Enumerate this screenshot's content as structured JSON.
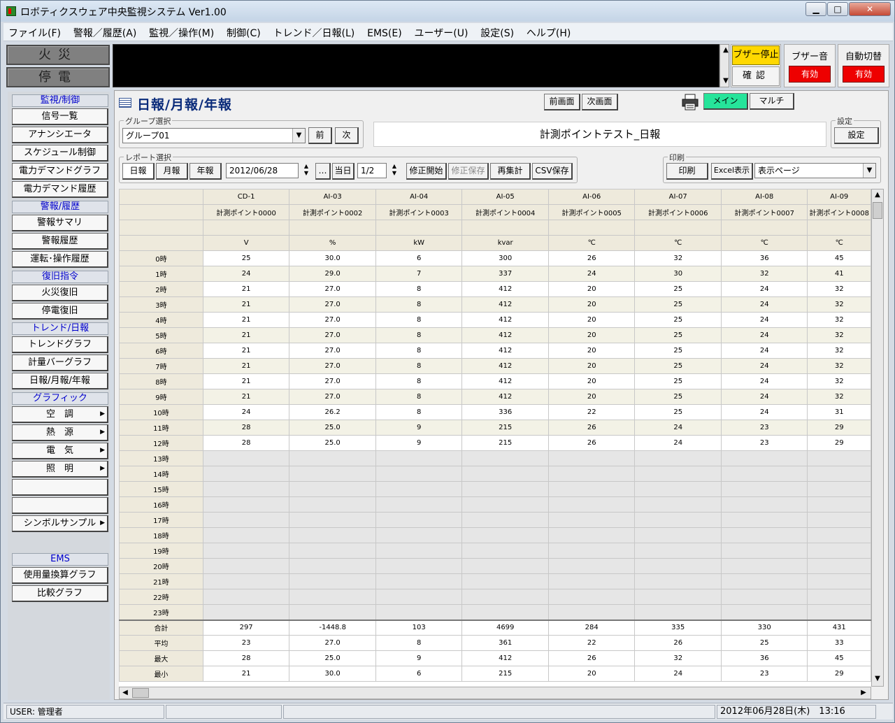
{
  "window": {
    "title": "ロボティクスウェア中央監視システム Ver1.00",
    "min": "▁",
    "max": "□",
    "close": "✕"
  },
  "menu": [
    "ファイル(F)",
    "警報／履歴(A)",
    "監視／操作(M)",
    "制御(C)",
    "トレンド／日報(L)",
    "EMS(E)",
    "ユーザー(U)",
    "設定(S)",
    "ヘルプ(H)"
  ],
  "alarms": {
    "fire": "火災",
    "power": "停電"
  },
  "buzzer": {
    "stop": "ブザー停止",
    "confirm": "確認",
    "sound_label": "ブザー音",
    "sound_state": "有効",
    "auto_label": "自動切替",
    "auto_state": "有効"
  },
  "sidebar": {
    "sec1": "監視/制御",
    "items1": [
      "信号一覧",
      "アナンシエータ",
      "スケジュール制御",
      "電力デマンドグラフ",
      "電力デマンド履歴"
    ],
    "sec2": "警報/履歴",
    "items2": [
      "警報サマリ",
      "警報履歴",
      "運転･操作履歴"
    ],
    "sec3": "復旧指令",
    "items3": [
      "火災復旧",
      "停電復旧"
    ],
    "sec4": "トレンド/日報",
    "items4": [
      "トレンドグラフ",
      "計量バーグラフ",
      "日報/月報/年報"
    ],
    "sec5": "グラフィック",
    "items5": [
      "空　調",
      "熱　源",
      "電　気",
      "照　明"
    ],
    "symbol": "シンボルサンプル",
    "sec6": "EMS",
    "items6": [
      "使用量換算グラフ",
      "比較グラフ"
    ]
  },
  "page": {
    "title": "日報/月報/年報",
    "prev_screen": "前画面",
    "next_screen": "次画面",
    "main": "メイン",
    "multi": "マルチ"
  },
  "group": {
    "legend": "グループ選択",
    "value": "グループ01",
    "prev": "前",
    "next": "次"
  },
  "report_name": "計測ポイントテスト_日報",
  "settings": {
    "legend": "設定",
    "button": "設定"
  },
  "report": {
    "legend": "レポート選択",
    "daily": "日報",
    "monthly": "月報",
    "yearly": "年報",
    "date": "2012/06/28",
    "ellipsis": "…",
    "today": "当日",
    "page": "1/2",
    "edit_start": "修正開始",
    "edit_save": "修正保存",
    "recalc": "再集計",
    "csv": "CSV保存"
  },
  "print": {
    "legend": "印刷",
    "print": "印刷",
    "excel": "Excel表示",
    "target": "表示ページ"
  },
  "table": {
    "columns": [
      {
        "id": "CD-1",
        "name": "計測ポイント0000",
        "unit": "V"
      },
      {
        "id": "AI-03",
        "name": "計測ポイント0002",
        "unit": "%"
      },
      {
        "id": "AI-04",
        "name": "計測ポイント0003",
        "unit": "kW"
      },
      {
        "id": "AI-05",
        "name": "計測ポイント0004",
        "unit": "kvar"
      },
      {
        "id": "AI-06",
        "name": "計測ポイント0005",
        "unit": "℃"
      },
      {
        "id": "AI-07",
        "name": "計測ポイント0006",
        "unit": "℃"
      },
      {
        "id": "AI-08",
        "name": "計測ポイント0007",
        "unit": "℃"
      },
      {
        "id": "AI-09",
        "name": "計測ポイント0008",
        "unit": "℃"
      }
    ],
    "hours": [
      "0時",
      "1時",
      "2時",
      "3時",
      "4時",
      "5時",
      "6時",
      "7時",
      "8時",
      "9時",
      "10時",
      "11時",
      "12時",
      "13時",
      "14時",
      "15時",
      "16時",
      "17時",
      "18時",
      "19時",
      "20時",
      "21時",
      "22時",
      "23時"
    ],
    "rows": [
      [
        "25",
        "30.0",
        "6",
        "300",
        "26",
        "32",
        "36",
        "45"
      ],
      [
        "24",
        "29.0",
        "7",
        "337",
        "24",
        "30",
        "32",
        "41"
      ],
      [
        "21",
        "27.0",
        "8",
        "412",
        "20",
        "25",
        "24",
        "32"
      ],
      [
        "21",
        "27.0",
        "8",
        "412",
        "20",
        "25",
        "24",
        "32"
      ],
      [
        "21",
        "27.0",
        "8",
        "412",
        "20",
        "25",
        "24",
        "32"
      ],
      [
        "21",
        "27.0",
        "8",
        "412",
        "20",
        "25",
        "24",
        "32"
      ],
      [
        "21",
        "27.0",
        "8",
        "412",
        "20",
        "25",
        "24",
        "32"
      ],
      [
        "21",
        "27.0",
        "8",
        "412",
        "20",
        "25",
        "24",
        "32"
      ],
      [
        "21",
        "27.0",
        "8",
        "412",
        "20",
        "25",
        "24",
        "32"
      ],
      [
        "21",
        "27.0",
        "8",
        "412",
        "20",
        "25",
        "24",
        "32"
      ],
      [
        "24",
        "26.2",
        "8",
        "336",
        "22",
        "25",
        "24",
        "31"
      ],
      [
        "28",
        "25.0",
        "9",
        "215",
        "26",
        "24",
        "23",
        "29"
      ],
      [
        "28",
        "25.0",
        "9",
        "215",
        "26",
        "24",
        "23",
        "29"
      ]
    ],
    "summary": [
      {
        "label": "合計",
        "values": [
          "297",
          "-1448.8",
          "103",
          "4699",
          "284",
          "335",
          "330",
          "431"
        ]
      },
      {
        "label": "平均",
        "values": [
          "23",
          "27.0",
          "8",
          "361",
          "22",
          "26",
          "25",
          "33"
        ]
      },
      {
        "label": "最大",
        "values": [
          "28",
          "25.0",
          "9",
          "412",
          "26",
          "32",
          "36",
          "45"
        ]
      },
      {
        "label": "最小",
        "values": [
          "21",
          "30.0",
          "6",
          "215",
          "20",
          "24",
          "23",
          "29"
        ]
      }
    ]
  },
  "status": {
    "user": "USER: 管理者",
    "datetime": "2012年06月28日(木)　13:16"
  }
}
